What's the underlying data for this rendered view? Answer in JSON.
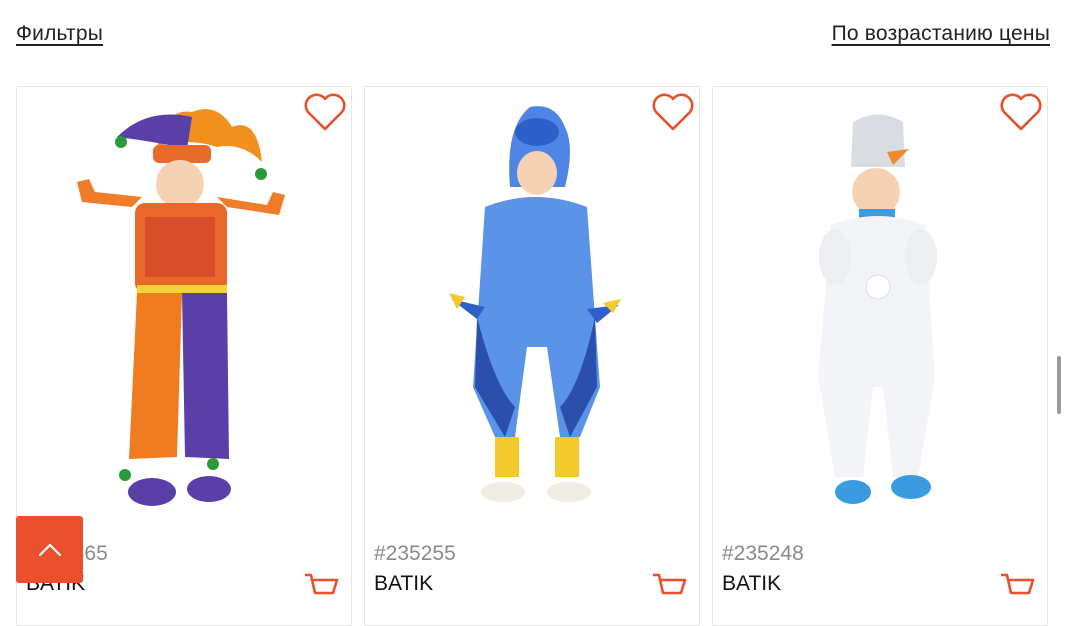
{
  "toolbar": {
    "filters_label": "Фильтры",
    "sort_label": "По возрастанию цены"
  },
  "products": [
    {
      "sku": "#235365",
      "brand": "BATIK",
      "image": "child-jester-costume"
    },
    {
      "sku": "#235255",
      "brand": "BATIK",
      "image": "child-blue-fish-costume"
    },
    {
      "sku": "#235248",
      "brand": "BATIK",
      "image": "child-snowman-costume"
    }
  ],
  "icons": {
    "favorite": "heart-outline-icon",
    "cart": "shopping-cart-icon",
    "back_to_top": "chevron-up-icon"
  },
  "colors": {
    "accent": "#e8512c",
    "text": "#222222",
    "muted": "#8a8a8a",
    "border": "#e6e6e6"
  }
}
